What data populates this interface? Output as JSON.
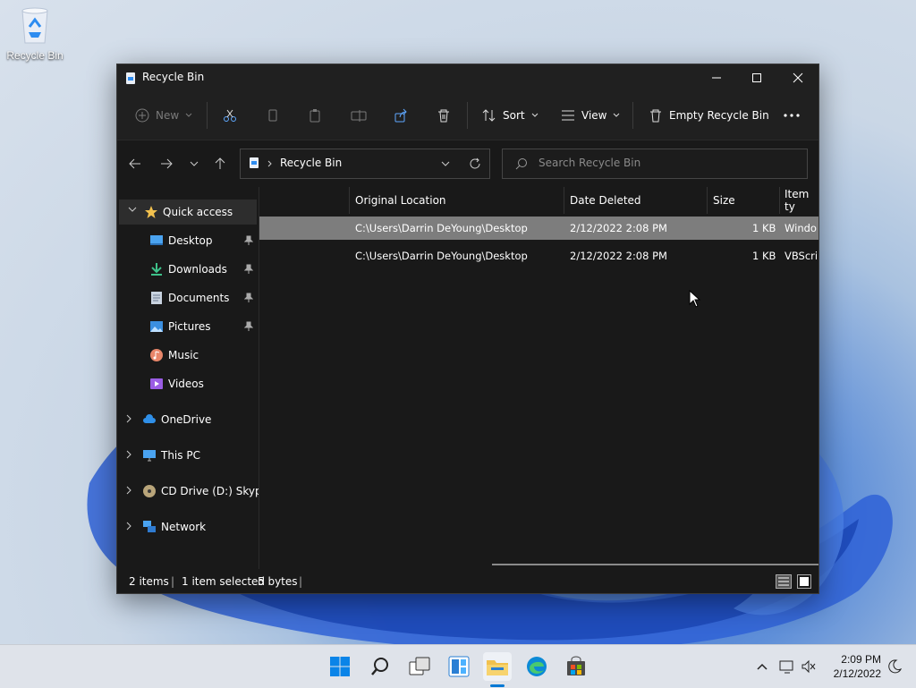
{
  "desktop": {
    "recycle_bin_label": "Recycle Bin"
  },
  "window": {
    "title": "Recycle Bin",
    "toolbar": {
      "new": "New",
      "sort": "Sort",
      "view": "View",
      "empty_recycle_bin": "Empty Recycle Bin"
    },
    "address": {
      "path": "Recycle Bin"
    },
    "search": {
      "placeholder": "Search Recycle Bin"
    },
    "nav": {
      "quick_access": "Quick access",
      "desktop": "Desktop",
      "downloads": "Downloads",
      "documents": "Documents",
      "pictures": "Pictures",
      "music": "Music",
      "videos": "Videos",
      "onedrive": "OneDrive",
      "this_pc": "This PC",
      "cd_drive": "CD Drive (D:) SkypeX",
      "network": "Network"
    },
    "columns": {
      "original_location": "Original Location",
      "date_deleted": "Date Deleted",
      "size": "Size",
      "item_type": "Item ty"
    },
    "rows": [
      {
        "location": "C:\\Users\\Darrin DeYoung\\Desktop",
        "date": "2/12/2022 2:08 PM",
        "size": "1 KB",
        "type": "Windo"
      },
      {
        "location": "C:\\Users\\Darrin DeYoung\\Desktop",
        "date": "2/12/2022 2:08 PM",
        "size": "1 KB",
        "type": "VBScrip"
      }
    ],
    "status": {
      "items": "2 items",
      "selected": "1 item selected",
      "bytes": "5 bytes"
    }
  },
  "taskbar": {
    "time": "2:09 PM",
    "date": "2/12/2022"
  },
  "colors": {
    "accent": "#0078d4",
    "window_bg": "#191919",
    "toolbar_bg": "#202020",
    "selected_row": "#7d7d7d",
    "folder_yellow": "#f2c14e"
  }
}
